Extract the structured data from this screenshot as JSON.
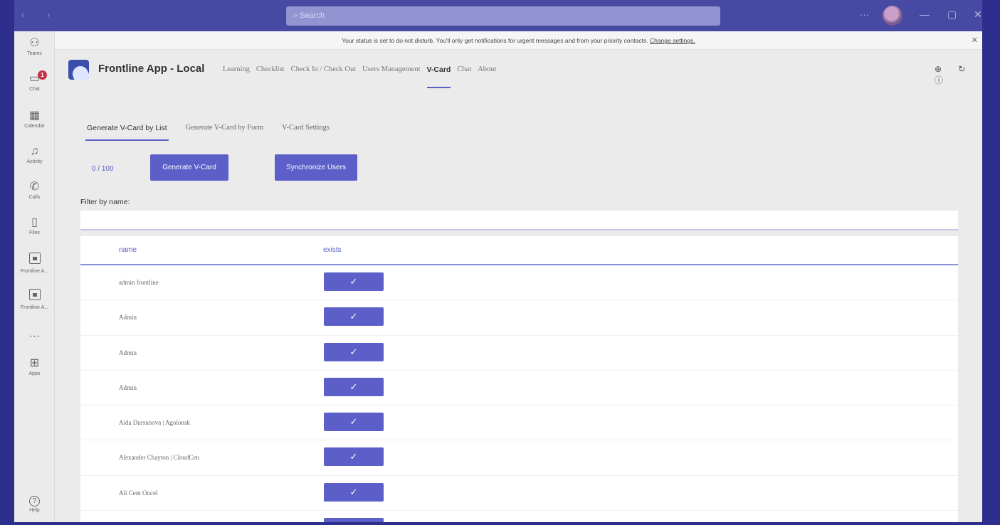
{
  "titlebar": {
    "search_placeholder": "Search",
    "more": "···",
    "minimize": "—",
    "maximize": "▢",
    "close": "✕",
    "nav": "‹ ›"
  },
  "rail": {
    "items": [
      {
        "label": "Teams",
        "icon": "teams-icon",
        "glyph": "⚇"
      },
      {
        "label": "Chat",
        "icon": "chat-icon",
        "glyph": "▭",
        "badge": "1"
      },
      {
        "label": "Calendar",
        "icon": "calendar-icon",
        "glyph": "▦"
      },
      {
        "label": "Activity",
        "icon": "bell-icon",
        "glyph": "♫"
      },
      {
        "label": "Calls",
        "icon": "phone-icon",
        "glyph": "✆"
      },
      {
        "label": "Files",
        "icon": "file-icon",
        "glyph": "▯"
      },
      {
        "label": "Frontline A...",
        "icon": "app-icon"
      },
      {
        "label": "Frontline A...",
        "icon": "app-icon"
      }
    ],
    "more": "···",
    "apps_label": "Apps",
    "apps_glyph": "⊞",
    "help_label": "Help",
    "help_glyph": "?"
  },
  "banner": {
    "text": "Your status is set to do not disturb. You'll only get notifications for urgent messages and from your priority contacts.",
    "link": "Change settings.",
    "close": "✕"
  },
  "app": {
    "title": "Frontline App - Local",
    "tabs": [
      "Learning",
      "Checklist",
      "Check In / Check Out",
      "Users Management",
      "V-Card",
      "Chat",
      "About"
    ],
    "active_tab": "V-Card",
    "header_icons": "⊕ ↻ ⓘ"
  },
  "vcard": {
    "subtabs": [
      "Generate V-Card by List",
      "Generate V-Card by Form",
      "V-Card Settings"
    ],
    "active_subtab": "Generate V-Card by List",
    "counter": "0 / 100",
    "generate_button": "Generate V-Card",
    "sync_button": "Synchronize Users",
    "filter_label": "Filter by name:",
    "filter_value": "",
    "columns": {
      "name": "name",
      "exists": "exists"
    },
    "check_glyph": "✓",
    "rows": [
      {
        "name": "admin frontline",
        "exists": true
      },
      {
        "name": "Admin",
        "exists": true
      },
      {
        "name": "Admin",
        "exists": true
      },
      {
        "name": "Admin",
        "exists": true
      },
      {
        "name": "Aida Dursunova | Agolonsk",
        "exists": true
      },
      {
        "name": "Alexander Chayton | CloudCen",
        "exists": true
      },
      {
        "name": "Ali Cem Oncel",
        "exists": true
      },
      {
        "name": "",
        "exists": true
      }
    ]
  },
  "colors": {
    "accent": "#5b5fc7",
    "titlebar": "#474aa2",
    "frame": "#2e2e8c",
    "badge": "#c4314b"
  }
}
